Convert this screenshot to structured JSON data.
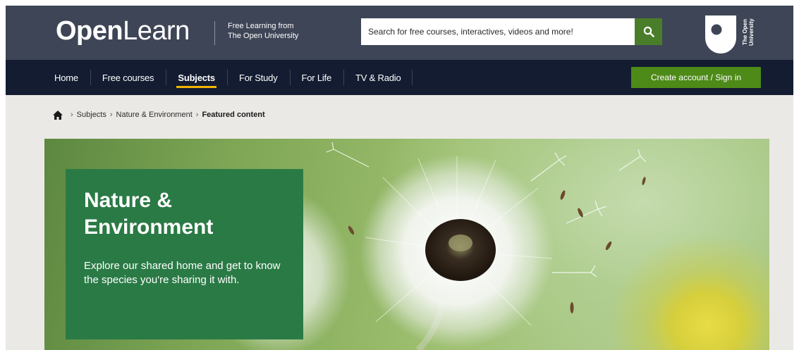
{
  "brand": {
    "logo_bold": "Open",
    "logo_light": "Learn",
    "tagline_line1": "Free Learning from",
    "tagline_line2": "The Open University",
    "ou_logo_text": "The Open\nUniversity"
  },
  "search": {
    "placeholder": "Search for free courses, interactives, videos and more!",
    "button_icon": "search-icon"
  },
  "nav": {
    "items": [
      {
        "label": "Home"
      },
      {
        "label": "Free courses"
      },
      {
        "label": "Subjects",
        "active": true
      },
      {
        "label": "For Study"
      },
      {
        "label": "For Life"
      },
      {
        "label": "TV & Radio"
      }
    ],
    "cta_label": "Create account / Sign in"
  },
  "breadcrumb": {
    "home_icon": "home-icon",
    "items": [
      "Subjects",
      "Nature & Environment"
    ],
    "separator": "›",
    "current": "Featured content"
  },
  "hero": {
    "title": "Nature & Environment",
    "description": "Explore our shared home and get to know the species you're sharing it with."
  },
  "colors": {
    "header_bg": "#3e4556",
    "nav_bg": "#131c31",
    "accent_green": "#4d8a17",
    "hero_card": "#2a7a45",
    "active_underline": "#f0b400",
    "page_bg": "#ebe9e6"
  }
}
